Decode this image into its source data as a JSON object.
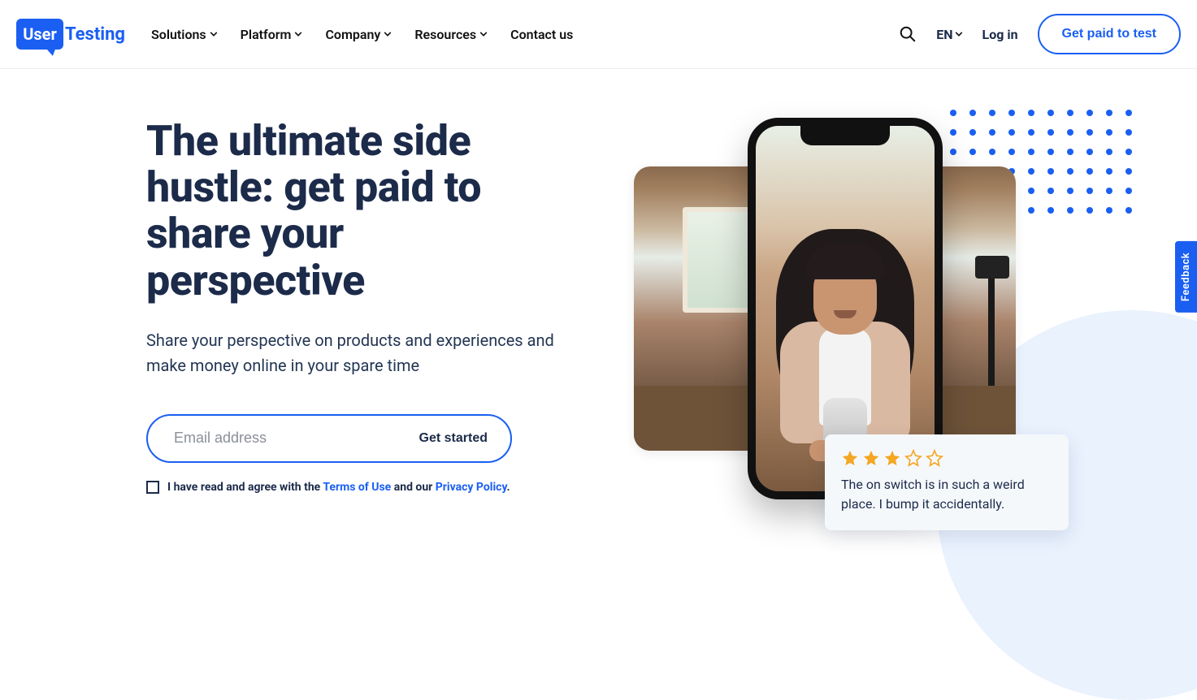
{
  "logo": {
    "bubble": "User",
    "rest": "Testing"
  },
  "nav": {
    "items": [
      {
        "label": "Solutions"
      },
      {
        "label": "Platform"
      },
      {
        "label": "Company"
      },
      {
        "label": "Resources"
      },
      {
        "label": "Contact us"
      }
    ]
  },
  "header": {
    "lang": "EN",
    "login": "Log in",
    "cta": "Get paid to test"
  },
  "hero": {
    "headline": "The ultimate side hustle: get paid to share your perspective",
    "sub": "Share your perspective on products and experiences and make money online in your spare time",
    "email_placeholder": "Email address",
    "get_started": "Get started",
    "consent_prefix": "I have read and agree with the ",
    "terms": "Terms of Use",
    "consent_mid": " and our ",
    "privacy": "Privacy Policy",
    "consent_suffix": "."
  },
  "review": {
    "rating": 3,
    "max": 5,
    "text": "The on switch is in such a weird place. I bump it accidentally."
  },
  "feedback": "Feedback"
}
